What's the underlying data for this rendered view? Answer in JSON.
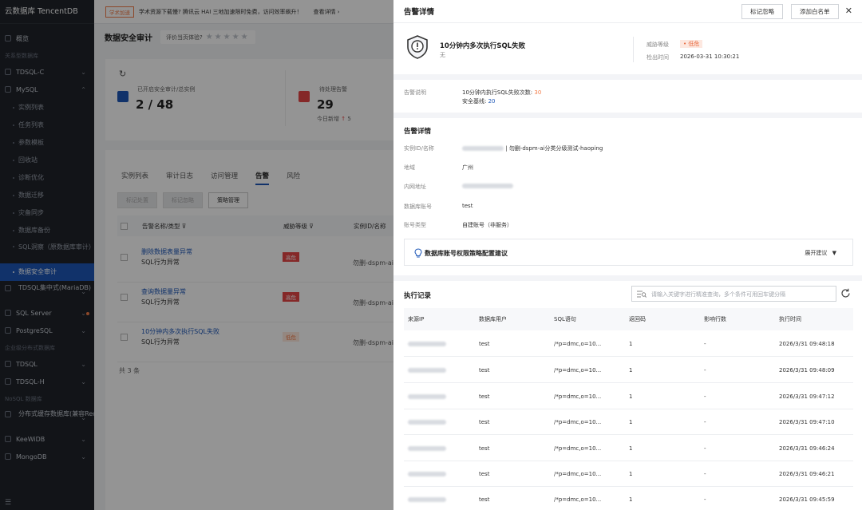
{
  "sidebar": {
    "brand": "云数据库 TencentDB",
    "overview": "概览",
    "group_relational": "关系型数据库",
    "tdsql_c": "TDSQL-C",
    "mysql": "MySQL",
    "mysql_children": [
      "实例列表",
      "任务列表",
      "参数模板",
      "回收站",
      "诊断优化",
      "数据迁移",
      "灾备同步",
      "数据库备份"
    ],
    "sql_insight": "SQL洞察（原数据库审计）",
    "active_item": "数据安全审计",
    "tdsql_mariadb": "TDSQL集中式(MariaDB)",
    "sql_server": "SQL Server",
    "postgresql": "PostgreSQL",
    "group_distributed": "企业级分布式数据库",
    "tdsql": "TDSQL",
    "tdsql_h": "TDSQL-H",
    "group_nosql": "NoSQL 数据库",
    "redis": "分布式缓存数据库(兼容Redis)",
    "keewidb": "KeeWiDB",
    "mongodb": "MongoDB"
  },
  "topbar": {
    "tag": "学术加速",
    "notice": "学术资源下载慢? 腾讯云 HAI 三地加速限时免费，访问效率飙升！",
    "link": "查看详情 ›"
  },
  "page": {
    "title": "数据安全审计",
    "rate_label": "评价当页体验?",
    "stats": [
      {
        "label": "已开启安全审计/总实例",
        "value": "2 / 48"
      },
      {
        "label": "待处理告警",
        "value": "29",
        "sub": "今日新增",
        "sub_value": "5"
      }
    ],
    "tabs": [
      "实例列表",
      "审计日志",
      "访问管理",
      "告警",
      "风险"
    ],
    "active_tab": "告警",
    "actions": [
      "标记处置",
      "标记忽略",
      "策略管理"
    ],
    "columns": [
      "告警名称/类型",
      "威胁等级",
      "实例ID/名称"
    ],
    "rows": [
      {
        "name": "删除数据表量异常",
        "type": "SQL行为异常",
        "level": "高危",
        "inst": "勿删-dspm-ai"
      },
      {
        "name": "查询数据量异常",
        "type": "SQL行为异常",
        "level": "高危",
        "inst": "勿删-dspm-ai"
      },
      {
        "name": "10分钟内多次执行SQL失败",
        "type": "SQL行为异常",
        "level": "低危",
        "inst": "勿删-dspm-ai"
      }
    ],
    "total": "共 3 条"
  },
  "drawer": {
    "title": "告警详情",
    "btn_ignore": "标记忽略",
    "btn_whitelist": "添加白名单",
    "close": "✕",
    "alert_name": "10分钟内多次执行SQL失败",
    "alert_sub": "无",
    "threat_label": "威胁等级",
    "threat_value": "• 低危",
    "detect_label": "检出时间",
    "detect_value": "2026-03-31 10:30:21",
    "desc_label": "告警说明",
    "desc_line1_prefix": "10分钟内执行SQL失败次数:",
    "desc_line1_value": "30",
    "desc_line2_prefix": "安全基线:",
    "desc_line2_value": "20",
    "detail_title": "告警详情",
    "fields": [
      {
        "label": "实例ID/名称",
        "value": "| 勿删-dspm-ai分类分级测试-haoping"
      },
      {
        "label": "地域",
        "value": "广州"
      },
      {
        "label": "内网地址",
        "value": ""
      },
      {
        "label": "数据库账号",
        "value": "test"
      },
      {
        "label": "账号类型",
        "value": "自建账号（非服务）"
      }
    ],
    "suggest_title": "数据库账号权限策略配置建议",
    "suggest_expand": "展开建议",
    "exec_title": "执行记录",
    "search_placeholder": "请输入关键字进行精准查询，多个条件可用回车键分隔",
    "columns": [
      "来源IP",
      "数据库用户",
      "SQL语句",
      "返回码",
      "影响行数",
      "执行时间"
    ],
    "records": [
      {
        "user": "test",
        "sql": "/*p=dmc,o=10...",
        "code": "1",
        "rows": "-",
        "time": "2026/3/31 09:48:18"
      },
      {
        "user": "test",
        "sql": "/*p=dmc,o=10...",
        "code": "1",
        "rows": "-",
        "time": "2026/3/31 09:48:09"
      },
      {
        "user": "test",
        "sql": "/*p=dmc,o=10...",
        "code": "1",
        "rows": "-",
        "time": "2026/3/31 09:47:12"
      },
      {
        "user": "test",
        "sql": "/*p=dmc,o=10...",
        "code": "1",
        "rows": "-",
        "time": "2026/3/31 09:47:10"
      },
      {
        "user": "test",
        "sql": "/*p=dmc,o=10...",
        "code": "1",
        "rows": "-",
        "time": "2026/3/31 09:46:24"
      },
      {
        "user": "test",
        "sql": "/*p=dmc,o=10...",
        "code": "1",
        "rows": "-",
        "time": "2026/3/31 09:46:21"
      },
      {
        "user": "test",
        "sql": "/*p=dmc,o=10...",
        "code": "1",
        "rows": "-",
        "time": "2026/3/31 09:45:59"
      }
    ]
  },
  "colors": {
    "accent": "#1e57b7",
    "danger": "#e54545",
    "warn": "#f27c49",
    "sidebar": "#1f232a"
  }
}
